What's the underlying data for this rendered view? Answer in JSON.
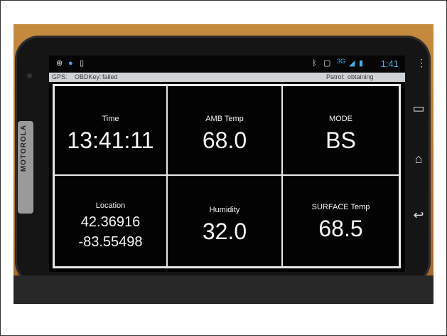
{
  "status_bar": {
    "time": "1:41",
    "network": "3G"
  },
  "info_bar": {
    "gps_label": "GPS:",
    "obd_label": "OBDKey:",
    "obd_status": "failed",
    "patrol_label": "Patrol:",
    "patrol_status": "obtaining"
  },
  "tiles": [
    {
      "label": "Time",
      "value": "13:41:11"
    },
    {
      "label": "AMB Temp",
      "value": "68.0"
    },
    {
      "label": "MODE",
      "value": "BS"
    },
    {
      "label": "Location",
      "lat": "42.36916",
      "lon": "-83.55498"
    },
    {
      "label": "Humidity",
      "value": "32.0"
    },
    {
      "label": "SURFACE Temp",
      "value": "68.5"
    }
  ],
  "device": {
    "brand": "MOTOROLA"
  },
  "icons": {
    "status_left": [
      "steering-wheel-icon",
      "info-icon",
      "device-icon"
    ],
    "status_right": [
      "bluetooth-icon",
      "vibrate-icon",
      "3g-icon",
      "signal-icon",
      "battery-icon"
    ],
    "nav": [
      "menu-dots-icon",
      "recent-apps-icon",
      "home-icon",
      "back-icon"
    ]
  }
}
